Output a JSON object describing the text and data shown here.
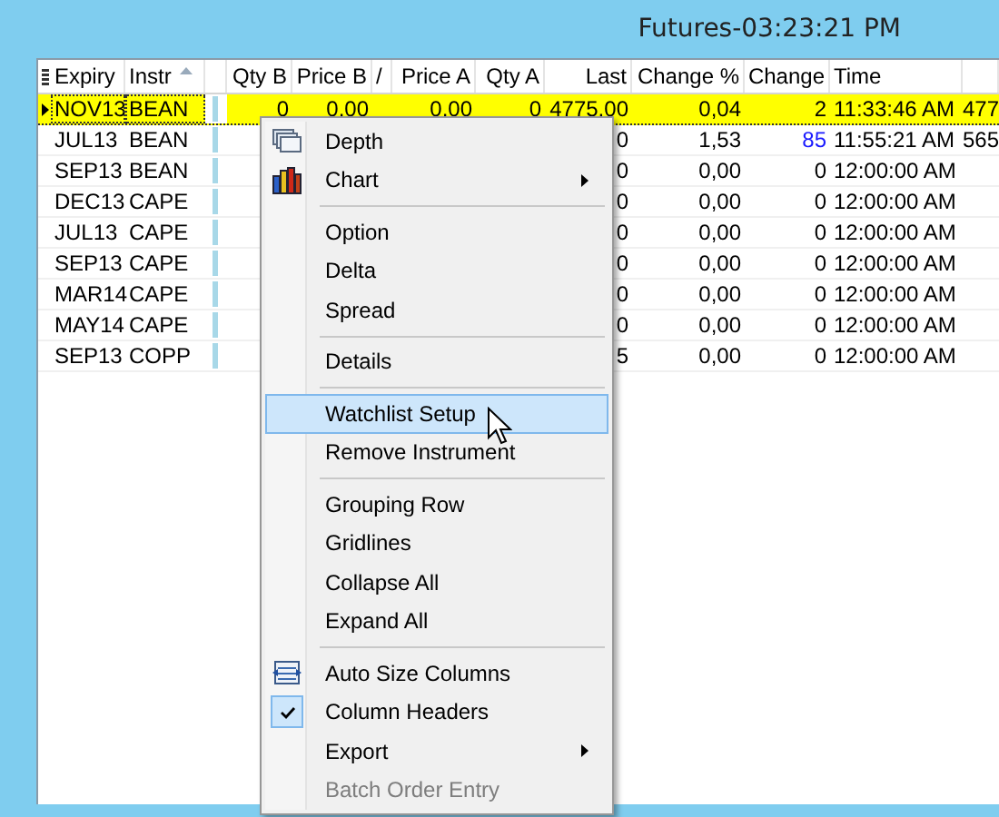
{
  "window": {
    "title": "Futures-03:23:21 PM"
  },
  "table": {
    "columns": [
      {
        "label": "Expiry",
        "sorted": false
      },
      {
        "label": "Instr",
        "sorted": true
      },
      {
        "sorted": false
      },
      {
        "label": "Qty B",
        "sorted": false
      },
      {
        "label": "Price B",
        "sorted": false
      },
      {
        "label": "/",
        "sorted": false
      },
      {
        "label": "Price A",
        "sorted": false
      },
      {
        "label": "Qty A",
        "sorted": false
      },
      {
        "label": "Last",
        "sorted": false
      },
      {
        "label": "Change %",
        "sorted": false
      },
      {
        "label": "Change",
        "sorted": false
      },
      {
        "label": "Time",
        "sorted": false
      },
      {
        "sorted": false
      }
    ],
    "rows": [
      {
        "selected": true,
        "expiry": "NOV13",
        "instr": "BEAN",
        "qty_b": "0",
        "price_b": "0,00",
        "price_a": "0,00",
        "qty_a": "0",
        "last": "4775,00",
        "change_pct": "0,04",
        "change": {
          "text": "2",
          "color": "#000000"
        },
        "time": "11:33:46 AM",
        "column_13": "477"
      },
      {
        "selected": false,
        "expiry": "JUL13",
        "instr": "BEAN",
        "last": "0",
        "change_pct": "1,53",
        "change": {
          "text": "85",
          "color": "#1a1aff"
        },
        "time": "11:55:21 AM",
        "column_13": "565"
      },
      {
        "selected": false,
        "expiry": "SEP13",
        "instr": "BEAN",
        "last": "0",
        "change_pct": "0,00",
        "change": {
          "text": "0",
          "color": "#000000"
        },
        "time": "12:00:00 AM"
      },
      {
        "selected": false,
        "expiry": "DEC13",
        "instr": "CAPE",
        "last": "0",
        "change_pct": "0,00",
        "change": {
          "text": "0",
          "color": "#000000"
        },
        "time": "12:00:00 AM"
      },
      {
        "selected": false,
        "expiry": "JUL13",
        "instr": "CAPE",
        "last": "0",
        "change_pct": "0,00",
        "change": {
          "text": "0",
          "color": "#000000"
        },
        "time": "12:00:00 AM"
      },
      {
        "selected": false,
        "expiry": "SEP13",
        "instr": "CAPE",
        "last": "0",
        "change_pct": "0,00",
        "change": {
          "text": "0",
          "color": "#000000"
        },
        "time": "12:00:00 AM"
      },
      {
        "selected": false,
        "expiry": "MAR14",
        "instr": "CAPE",
        "last": "0",
        "change_pct": "0,00",
        "change": {
          "text": "0",
          "color": "#000000"
        },
        "time": "12:00:00 AM"
      },
      {
        "selected": false,
        "expiry": "MAY14",
        "instr": "CAPE",
        "last": "0",
        "change_pct": "0,00",
        "change": {
          "text": "0",
          "color": "#000000"
        },
        "time": "12:00:00 AM"
      },
      {
        "selected": false,
        "expiry": "SEP13",
        "instr": "COPP",
        "last": "5",
        "change_pct": "0,00",
        "change": {
          "text": "0",
          "color": "#000000"
        },
        "time": "12:00:00 AM"
      }
    ]
  },
  "context_menu": {
    "items": [
      {
        "kind": "command",
        "label": "Depth",
        "selected": false,
        "checked": false,
        "disabled": false,
        "submenu": false
      },
      {
        "kind": "command",
        "label": "Chart",
        "selected": false,
        "checked": false,
        "disabled": false,
        "submenu": true
      },
      {
        "kind": "separator"
      },
      {
        "kind": "command",
        "label": "Option",
        "selected": false,
        "checked": false,
        "disabled": false,
        "submenu": false
      },
      {
        "kind": "command",
        "label": "Delta",
        "selected": false,
        "checked": false,
        "disabled": false,
        "submenu": false
      },
      {
        "kind": "command",
        "label": "Spread",
        "selected": false,
        "checked": false,
        "disabled": false,
        "submenu": false
      },
      {
        "kind": "separator"
      },
      {
        "kind": "command",
        "label": "Details",
        "selected": false,
        "checked": false,
        "disabled": false,
        "submenu": false
      },
      {
        "kind": "separator"
      },
      {
        "kind": "command",
        "label": "Watchlist Setup",
        "selected": true,
        "checked": false,
        "disabled": false,
        "submenu": false
      },
      {
        "kind": "command",
        "label": "Remove Instrument",
        "selected": false,
        "checked": false,
        "disabled": false,
        "submenu": false
      },
      {
        "kind": "separator"
      },
      {
        "kind": "command",
        "label": "Grouping Row",
        "selected": false,
        "checked": false,
        "disabled": false,
        "submenu": false
      },
      {
        "kind": "command",
        "label": "Gridlines",
        "selected": false,
        "checked": false,
        "disabled": false,
        "submenu": false
      },
      {
        "kind": "command",
        "label": "Collapse All",
        "selected": false,
        "checked": false,
        "disabled": false,
        "submenu": false
      },
      {
        "kind": "command",
        "label": "Expand All",
        "selected": false,
        "checked": false,
        "disabled": false,
        "submenu": false
      },
      {
        "kind": "separator"
      },
      {
        "kind": "command",
        "label": "Auto Size Columns",
        "selected": false,
        "checked": false,
        "disabled": false,
        "submenu": false
      },
      {
        "kind": "command",
        "label": "Column Headers",
        "selected": false,
        "checked": true,
        "disabled": false,
        "submenu": false
      },
      {
        "kind": "command",
        "label": "Export",
        "selected": false,
        "checked": false,
        "disabled": false,
        "submenu": true
      },
      {
        "kind": "command",
        "label": "Batch Order Entry",
        "selected": false,
        "checked": false,
        "disabled": true,
        "submenu": false
      }
    ]
  }
}
